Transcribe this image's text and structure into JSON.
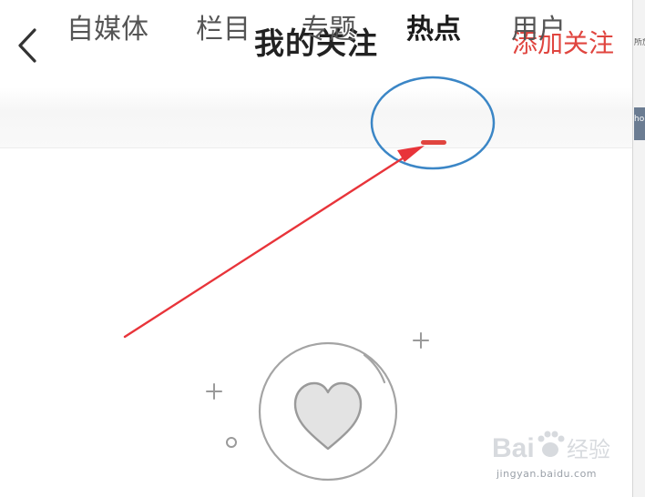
{
  "header": {
    "title": "我的关注",
    "add_follow_label": "添加关注"
  },
  "tabs": [
    {
      "label": "自媒体",
      "active": false
    },
    {
      "label": "栏目",
      "active": false
    },
    {
      "label": "专题",
      "active": false
    },
    {
      "label": "热点",
      "active": true
    },
    {
      "label": "用户",
      "active": false
    }
  ],
  "icons": {
    "back": "chevron-left-icon",
    "empty_state": "heart-icon"
  },
  "colors": {
    "accent": "#e0453f",
    "annotation_circle": "#3b86c6",
    "annotation_arrow": "#e8343a",
    "title_text": "#222222",
    "tab_text": "#555555",
    "illustration": "#9a9a9a"
  },
  "side_strip": {
    "text_1": "所旅",
    "text_2": "ho"
  },
  "watermark": {
    "logo_text": "Bai",
    "logo_suffix": "经验",
    "url": "jingyan.baidu.com"
  }
}
